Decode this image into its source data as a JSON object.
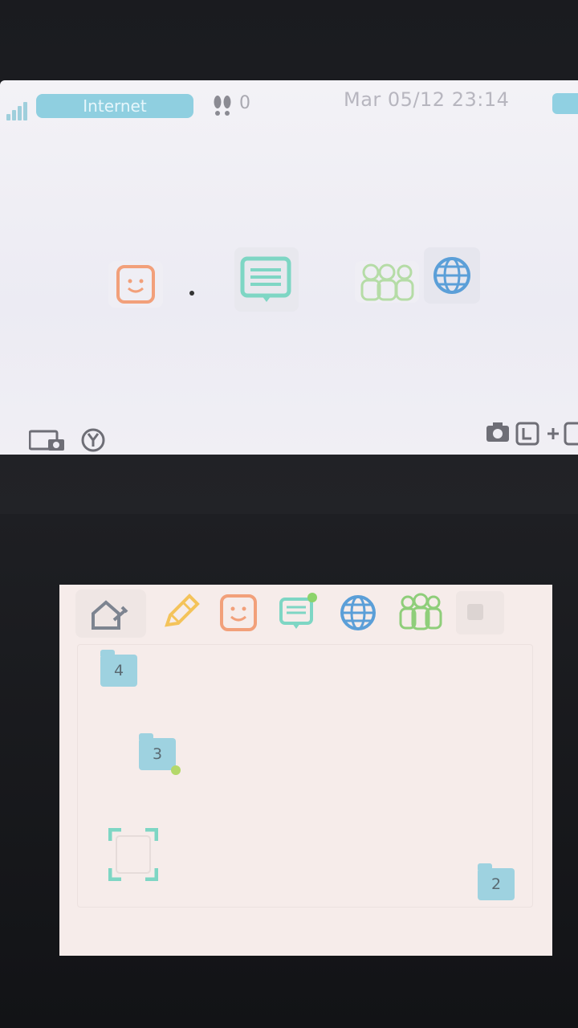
{
  "top_screen": {
    "status": {
      "connection_label": "Internet",
      "step_count": "0",
      "datetime": "Mar 05/12  23:14"
    }
  },
  "bottom_screen": {
    "folders": [
      {
        "number": "4"
      },
      {
        "number": "3"
      },
      {
        "number": "2"
      }
    ]
  },
  "colors": {
    "accent_blue": "#8fcfe0",
    "face_orange": "#f2a07a",
    "message_teal": "#7ed6c4",
    "globe_blue": "#5b9fd8",
    "people_green": "#8fce7a",
    "pencil_yellow": "#f4c35a"
  },
  "icons": {
    "top": [
      "signal-icon",
      "steps-icon",
      "battery-icon",
      "mii-face-icon",
      "message-icon",
      "friends-icon",
      "globe-icon",
      "camera-screen-icon",
      "y-button-icon",
      "camera-icon",
      "l-button-icon",
      "plus-icon",
      "r-button-icon"
    ],
    "bottom": [
      "settings-home-icon",
      "pencil-icon",
      "mii-face-icon",
      "notification-icon",
      "globe-icon",
      "friends-icon",
      "square-icon"
    ]
  }
}
